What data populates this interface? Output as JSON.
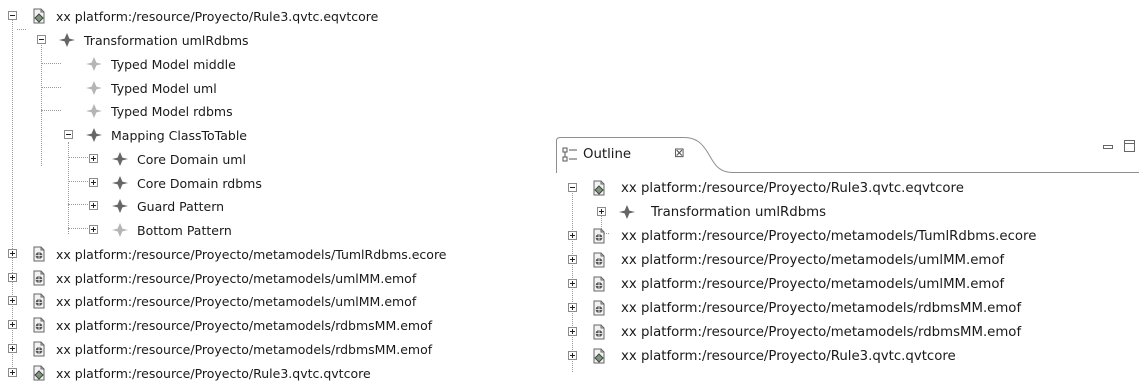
{
  "left_tree": [
    {
      "label": "xx platform:/resource/Proyecto/Rule3.qvtc.eqvtcore",
      "icon": "qvtc-file-icon",
      "toggle": "minus"
    },
    {
      "label": "Transformation umlRdbms",
      "icon": "transformation-icon",
      "toggle": "minus"
    },
    {
      "label": "Typed Model middle",
      "icon": "typed-model-icon",
      "toggle": "none"
    },
    {
      "label": "Typed Model uml",
      "icon": "typed-model-icon",
      "toggle": "none"
    },
    {
      "label": "Typed Model rdbms",
      "icon": "typed-model-icon",
      "toggle": "none"
    },
    {
      "label": "Mapping ClassToTable",
      "icon": "mapping-icon",
      "toggle": "minus"
    },
    {
      "label": "Core Domain uml",
      "icon": "core-domain-icon",
      "toggle": "plus"
    },
    {
      "label": "Core Domain rdbms",
      "icon": "core-domain-icon",
      "toggle": "plus"
    },
    {
      "label": "Guard Pattern",
      "icon": "pattern-icon",
      "toggle": "plus"
    },
    {
      "label": "Bottom Pattern",
      "icon": "pattern-icon",
      "toggle": "plus"
    },
    {
      "label": "xx platform:/resource/Proyecto/metamodels/TumlRdbms.ecore",
      "icon": "metamodel-file-icon",
      "toggle": "plus"
    },
    {
      "label": "xx platform:/resource/Proyecto/metamodels/umlMM.emof",
      "icon": "metamodel-file-icon",
      "toggle": "plus"
    },
    {
      "label": "xx platform:/resource/Proyecto/metamodels/umlMM.emof",
      "icon": "metamodel-file-icon",
      "toggle": "plus"
    },
    {
      "label": "xx platform:/resource/Proyecto/metamodels/rdbmsMM.emof",
      "icon": "metamodel-file-icon",
      "toggle": "plus"
    },
    {
      "label": "xx platform:/resource/Proyecto/metamodels/rdbmsMM.emof",
      "icon": "metamodel-file-icon",
      "toggle": "plus"
    },
    {
      "label": "xx platform:/resource/Proyecto/Rule3.qvtc.qvtcore",
      "icon": "qvtc-file-icon",
      "toggle": "plus"
    }
  ],
  "outline_view": {
    "tab_label": "Outline",
    "tab_icon": "outline-icon",
    "close_icon": "close-icon",
    "close_glyph": "⊠",
    "minimize_icon": "minimize-icon",
    "maximize_icon": "maximize-icon"
  },
  "outline_tree": [
    {
      "label": "xx platform:/resource/Proyecto/Rule3.qvtc.eqvtcore",
      "icon": "qvtc-file-icon",
      "toggle": "minus"
    },
    {
      "label": "Transformation umlRdbms",
      "icon": "transformation-icon",
      "toggle": "plus"
    },
    {
      "label": "xx platform:/resource/Proyecto/metamodels/TumlRdbms.ecore",
      "icon": "metamodel-file-icon",
      "toggle": "plus"
    },
    {
      "label": "xx platform:/resource/Proyecto/metamodels/umlMM.emof",
      "icon": "metamodel-file-icon",
      "toggle": "plus"
    },
    {
      "label": "xx platform:/resource/Proyecto/metamodels/umlMM.emof",
      "icon": "metamodel-file-icon",
      "toggle": "plus"
    },
    {
      "label": "xx platform:/resource/Proyecto/metamodels/rdbmsMM.emof",
      "icon": "metamodel-file-icon",
      "toggle": "plus"
    },
    {
      "label": "xx platform:/resource/Proyecto/metamodels/rdbmsMM.emof",
      "icon": "metamodel-file-icon",
      "toggle": "plus"
    },
    {
      "label": "xx platform:/resource/Proyecto/Rule3.qvtc.qvtcore",
      "icon": "qvtc-file-icon",
      "toggle": "plus"
    }
  ]
}
